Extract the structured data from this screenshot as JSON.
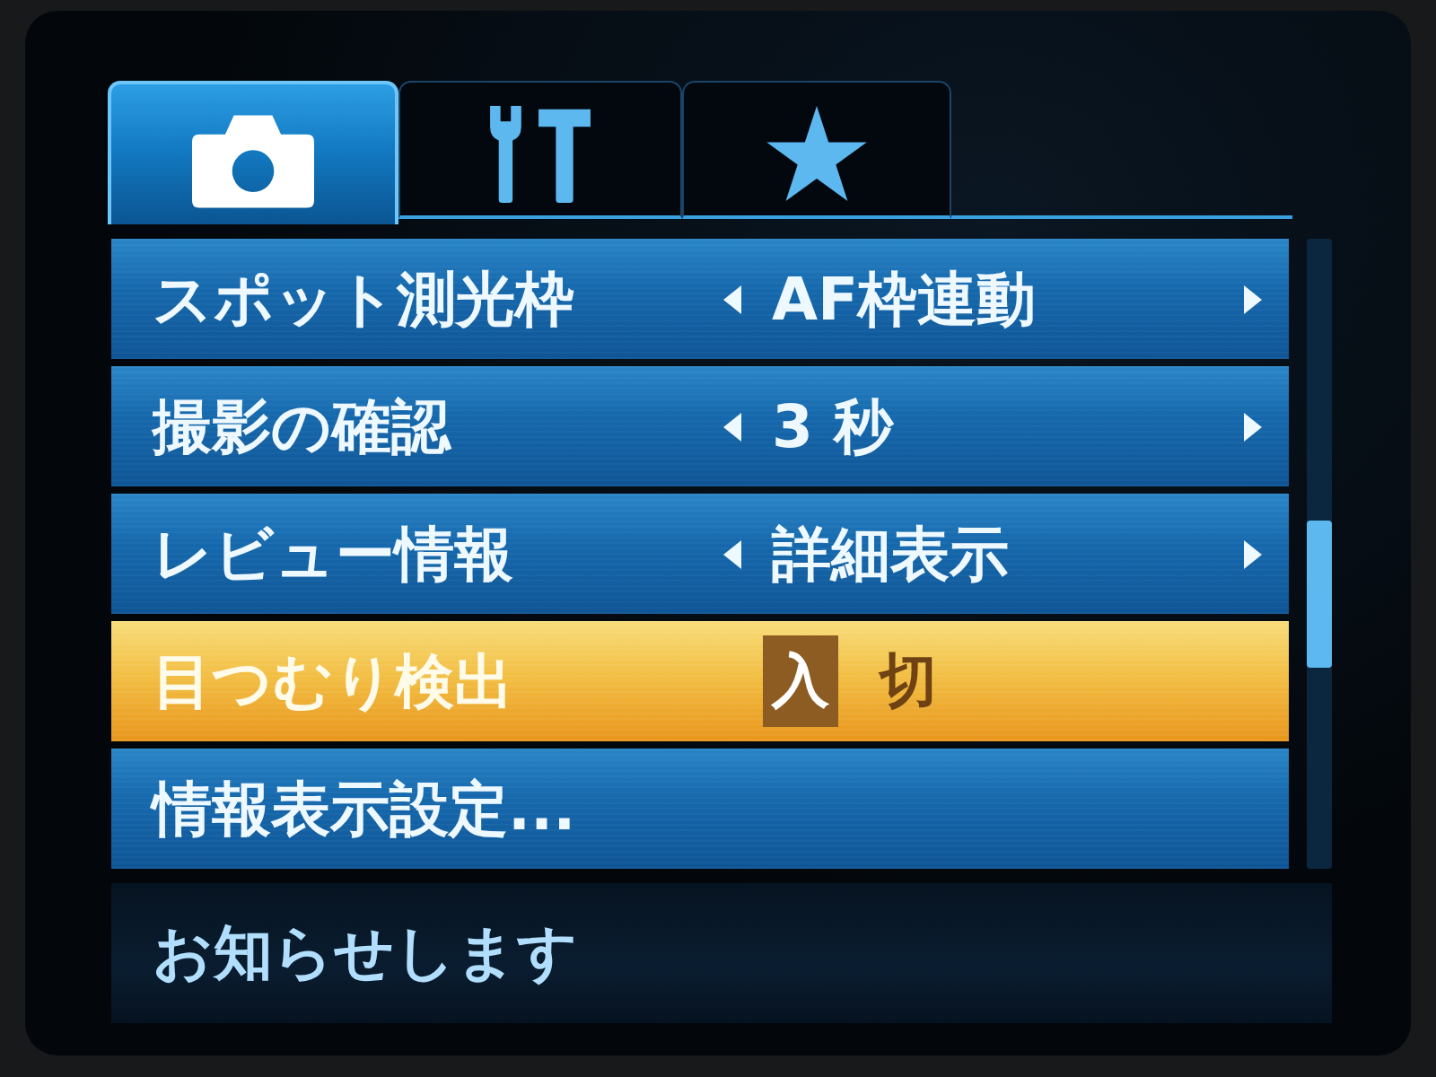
{
  "tabs": [
    {
      "kind": "camera",
      "selected": true
    },
    {
      "kind": "tools",
      "selected": false
    },
    {
      "kind": "star",
      "selected": false
    }
  ],
  "menu": {
    "items": [
      {
        "kind": "choice",
        "label": "スポット測光枠",
        "value": "AF枠連動",
        "selected": false
      },
      {
        "kind": "choice",
        "label": "撮影の確認",
        "value": "3 秒",
        "selected": false
      },
      {
        "kind": "choice",
        "label": "レビュー情報",
        "value": "詳細表示",
        "selected": false
      },
      {
        "kind": "toggle",
        "label": "目つむり検出",
        "selected": true,
        "options": [
          {
            "label": "入",
            "selected": true
          },
          {
            "label": "切",
            "selected": false
          }
        ]
      },
      {
        "kind": "submenu",
        "label": "情報表示設定...",
        "selected": false
      }
    ]
  },
  "footer": {
    "text": "お知らせします"
  }
}
